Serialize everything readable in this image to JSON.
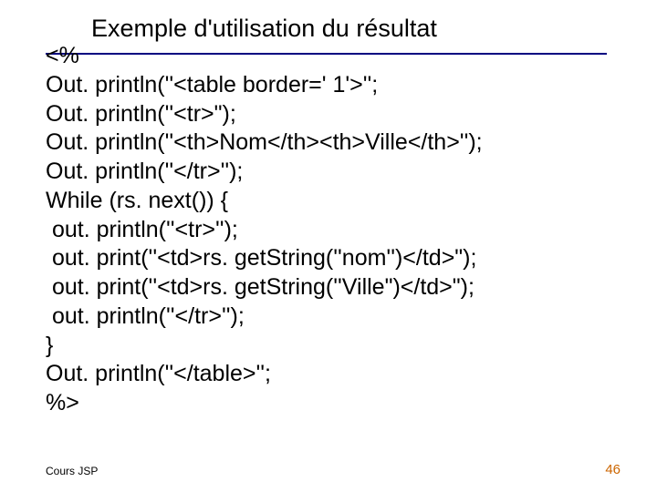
{
  "slide": {
    "title": "Exemple d'utilisation du résultat",
    "code": "<%\nOut. println(''<table border=' 1'>'';\nOut. println(''<tr>\");\nOut. println(''<th>Nom</th><th>Ville</th>'');\nOut. println(''</tr>'');\nWhile (rs. next()) {\n out. println(''<tr>'');\n out. print(''<td>rs. getString(''nom'')</td>\");\n out. print(''<td>rs. getString(''Ville\")</td>\");\n out. println(''</tr>'');\n}\nOut. println(''</table>'';\n%>",
    "footer_left": "Cours JSP",
    "footer_right": "46"
  }
}
